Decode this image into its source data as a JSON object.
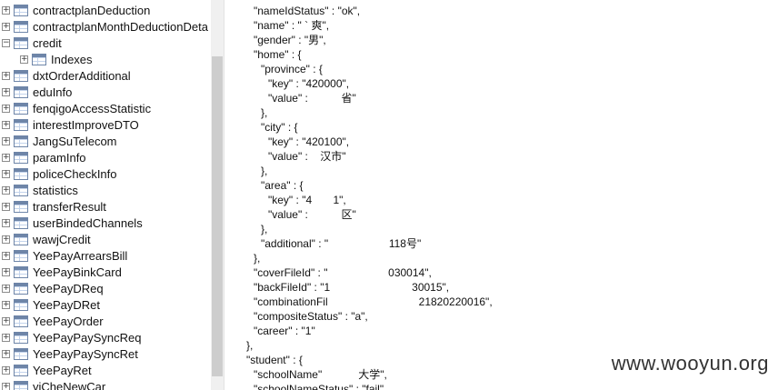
{
  "tree": {
    "items": [
      {
        "label": "contractplanDeduction",
        "expander": "+",
        "level": 0
      },
      {
        "label": "contractplanMonthDeductionDeta",
        "expander": "+",
        "level": 0
      },
      {
        "label": "credit",
        "expander": "−",
        "level": 0
      },
      {
        "label": "Indexes",
        "expander": "+",
        "level": 1
      },
      {
        "label": "dxtOrderAdditional",
        "expander": "+",
        "level": 0
      },
      {
        "label": "eduInfo",
        "expander": "+",
        "level": 0
      },
      {
        "label": "fenqigoAccessStatistic",
        "expander": "+",
        "level": 0
      },
      {
        "label": "interestImproveDTO",
        "expander": "+",
        "level": 0
      },
      {
        "label": "JangSuTelecom",
        "expander": "+",
        "level": 0
      },
      {
        "label": "paramInfo",
        "expander": "+",
        "level": 0
      },
      {
        "label": "policeCheckInfo",
        "expander": "+",
        "level": 0
      },
      {
        "label": "statistics",
        "expander": "+",
        "level": 0
      },
      {
        "label": "transferResult",
        "expander": "+",
        "level": 0
      },
      {
        "label": "userBindedChannels",
        "expander": "+",
        "level": 0
      },
      {
        "label": "wawjCredit",
        "expander": "+",
        "level": 0
      },
      {
        "label": "YeePayArrearsBill",
        "expander": "+",
        "level": 0
      },
      {
        "label": "YeePayBinkCard",
        "expander": "+",
        "level": 0
      },
      {
        "label": "YeePayDReq",
        "expander": "+",
        "level": 0
      },
      {
        "label": "YeePayDRet",
        "expander": "+",
        "level": 0
      },
      {
        "label": "YeePayOrder",
        "expander": "+",
        "level": 0
      },
      {
        "label": "YeePayPaySyncReq",
        "expander": "+",
        "level": 0
      },
      {
        "label": "YeePayPaySyncRet",
        "expander": "+",
        "level": 0
      },
      {
        "label": "YeePayRet",
        "expander": "+",
        "level": 0
      },
      {
        "label": "yiCheNewCar",
        "expander": "+",
        "level": 0
      }
    ]
  },
  "json_lines": [
    {
      "indent": 0,
      "text": "\"nameIdStatus\" : \"ok\","
    },
    {
      "indent": 0,
      "text": "\"name\" : \" ` 爽\","
    },
    {
      "indent": 0,
      "text": "\"gender\" : \"男\","
    },
    {
      "indent": 0,
      "text": "\"home\" : {"
    },
    {
      "indent": 1,
      "text": "\"province\" : {"
    },
    {
      "indent": 2,
      "text": "\"key\" : \"420000\","
    },
    {
      "indent": 2,
      "text": "\"value\" :           省\""
    },
    {
      "indent": 1,
      "text": "},"
    },
    {
      "indent": 1,
      "text": "\"city\" : {"
    },
    {
      "indent": 2,
      "text": "\"key\" : \"420100\","
    },
    {
      "indent": 2,
      "text": "\"value\" :    汉市\""
    },
    {
      "indent": 1,
      "text": "},"
    },
    {
      "indent": 1,
      "text": "\"area\" : {"
    },
    {
      "indent": 2,
      "text": "\"key\" : \"4       1\","
    },
    {
      "indent": 2,
      "text": "\"value\" :           区\""
    },
    {
      "indent": 1,
      "text": "},"
    },
    {
      "indent": 1,
      "text": "\"additional\" : \"                    118号\""
    },
    {
      "indent": 0,
      "text": "},"
    },
    {
      "indent": 0,
      "text": "\"coverFileId\" : \"                    030014\","
    },
    {
      "indent": 0,
      "text": "\"backFileId\" : \"1                           30015\","
    },
    {
      "indent": 0,
      "text": "\"combinationFil                              21820220016\","
    },
    {
      "indent": 0,
      "text": "\"compositeStatus\" : \"a\","
    },
    {
      "indent": 0,
      "text": "\"career\" : \"1\""
    },
    {
      "indent": -1,
      "text": "},"
    },
    {
      "indent": -1,
      "text": "\"student\" : {"
    },
    {
      "indent": 0,
      "text": "\"schoolName\"            大学\","
    },
    {
      "indent": 0,
      "text": "\"schoolNameStatus\" : \"fail\","
    }
  ],
  "watermark": "www.wooyun.org"
}
